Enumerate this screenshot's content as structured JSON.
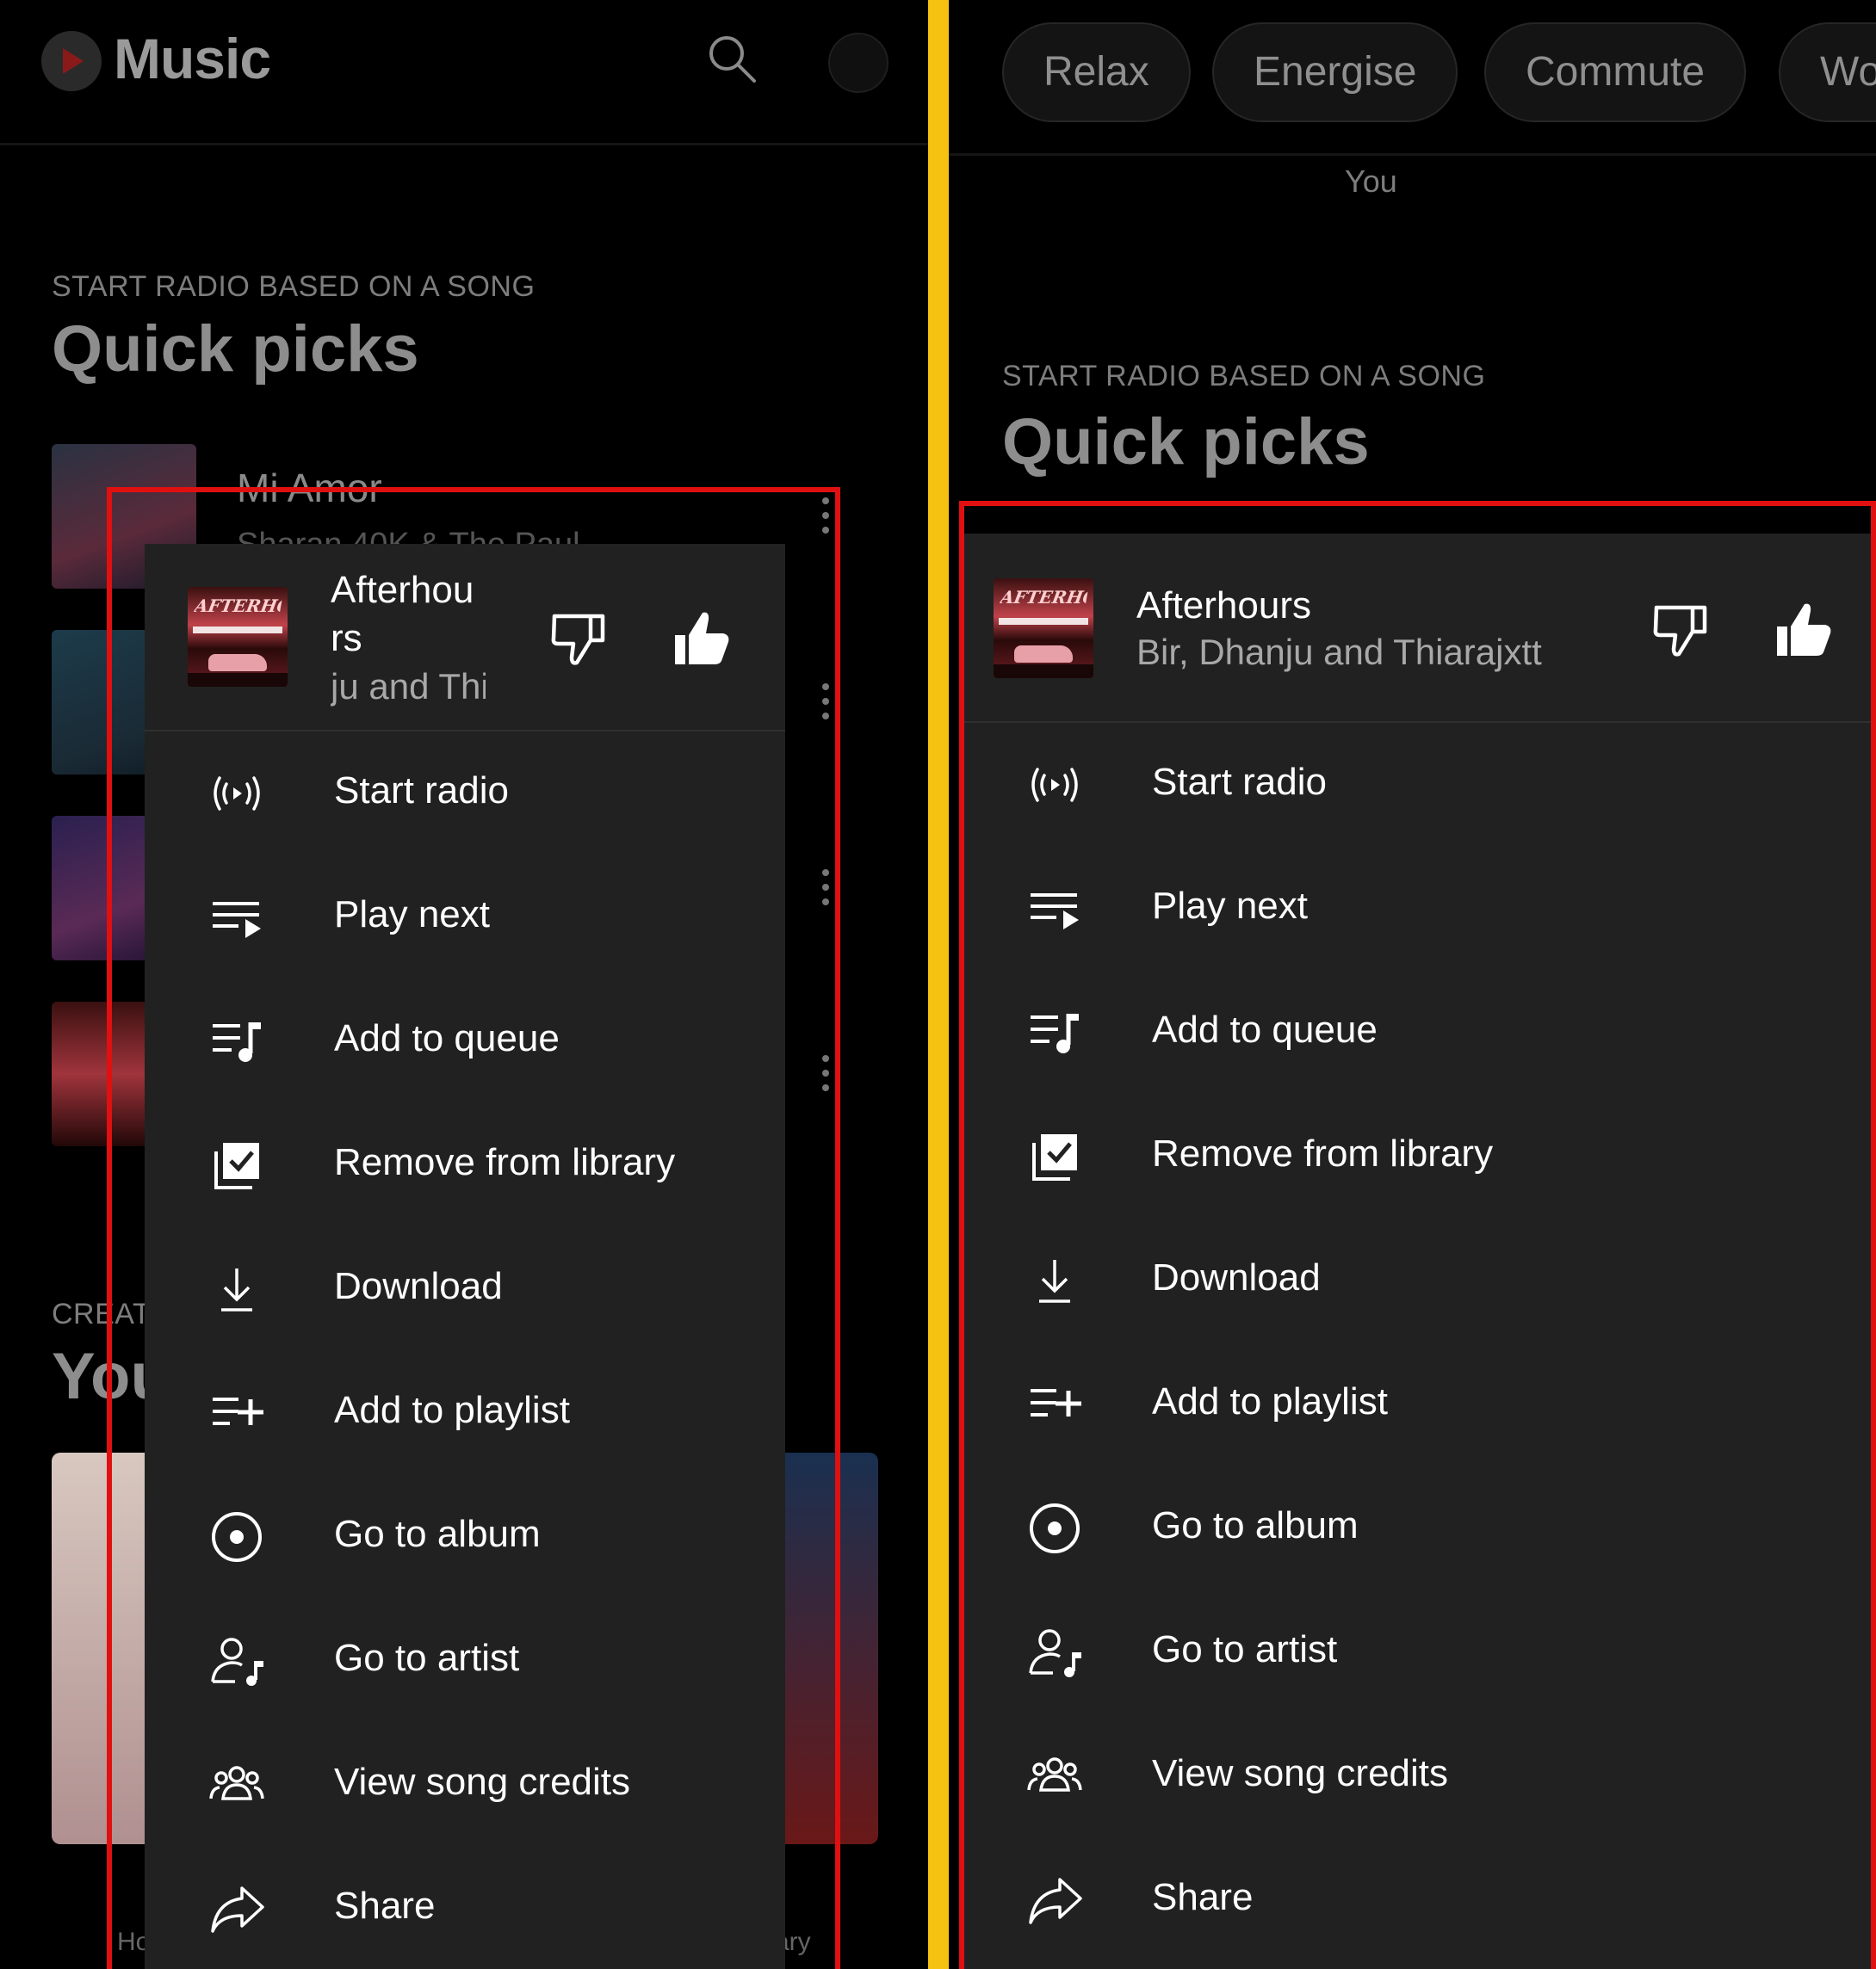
{
  "app": {
    "name": "Music"
  },
  "left": {
    "section1": {
      "kicker": "START RADIO BASED ON A SONG",
      "title": "Quick picks"
    },
    "bg_song": {
      "title": "Mi Amor",
      "artist": "Sharan 40K & The Paul"
    },
    "section2": {
      "kicker": "CREAT",
      "title": "You"
    },
    "nav": {
      "home": "Ho",
      "library": "ary"
    },
    "menu": {
      "song_title_line1": "Afterhou",
      "song_title_line2": "rs",
      "song_artist": "ju and Thi"
    }
  },
  "right": {
    "chips": [
      "Relax",
      "Energise",
      "Commute",
      "Wo"
    ],
    "you_label": "You",
    "section1": {
      "kicker": "START RADIO BASED ON A SONG",
      "title": "Quick picks"
    },
    "menu": {
      "song_title": "Afterhours",
      "song_artist": "Bir, Dhanju and Thiarajxtt"
    }
  },
  "album_art_text": "AFTERHOURS",
  "menu_items": [
    {
      "label": "Start radio",
      "icon": "radio-icon"
    },
    {
      "label": "Play next",
      "icon": "play-next-icon"
    },
    {
      "label": "Add to queue",
      "icon": "queue-icon"
    },
    {
      "label": "Remove from library",
      "icon": "library-check-icon"
    },
    {
      "label": "Download",
      "icon": "download-icon"
    },
    {
      "label": "Add to playlist",
      "icon": "playlist-add-icon"
    },
    {
      "label": "Go to album",
      "icon": "album-icon"
    },
    {
      "label": "Go to artist",
      "icon": "artist-icon"
    },
    {
      "label": "View song credits",
      "icon": "credits-icon"
    },
    {
      "label": "Share",
      "icon": "share-icon"
    }
  ],
  "colors": {
    "divider": "#f5c211",
    "highlight": "#e01010",
    "menu_bg": "#212121"
  }
}
